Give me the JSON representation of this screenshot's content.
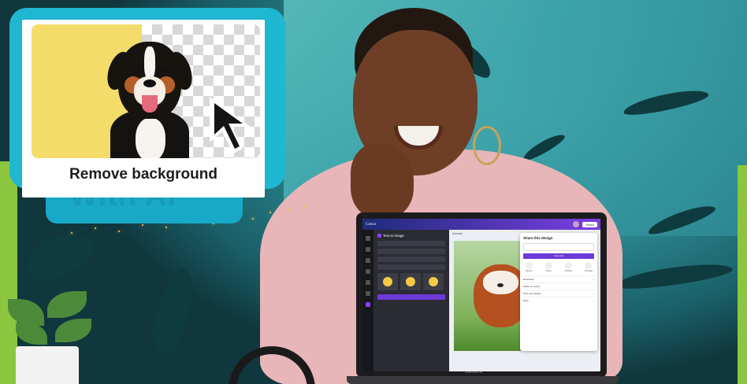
{
  "feature_card": {
    "label": "Remove background",
    "ghost_text": "With AI"
  },
  "laptop": {
    "brand_label": "MacBook Air",
    "app": {
      "logo": "Canva",
      "share_label": "Share",
      "panel_title": "Text to image",
      "canvas_header": "Animate",
      "share_popup": {
        "title": "Share this design",
        "copy_link": "Copy link",
        "icons": [
          "Present",
          "Share",
          "Website",
          "Template"
        ],
        "items": [
          "Download",
          "Share on social",
          "Print your design",
          "More"
        ]
      }
    }
  },
  "colors": {
    "card_border": "#1fb7d1",
    "accent_purple": "#8b3dff",
    "wall_teal": "#3fa7ad",
    "lime": "#8cc63f"
  }
}
